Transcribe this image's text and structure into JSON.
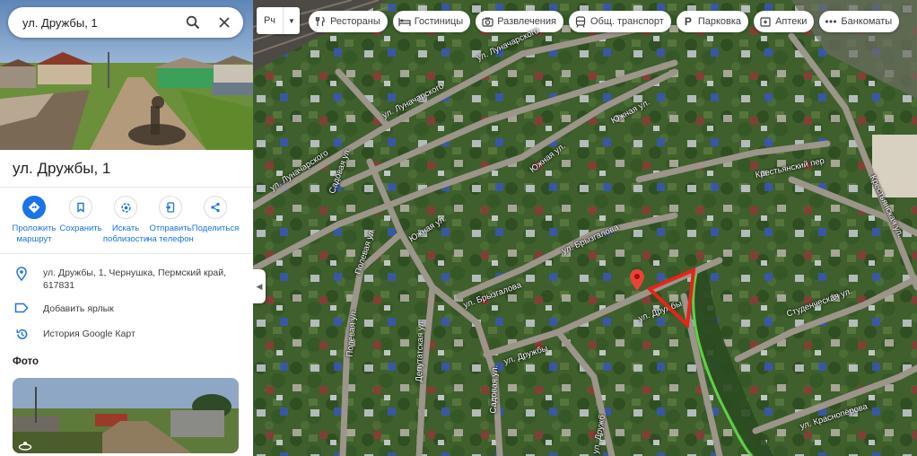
{
  "search": {
    "value": "ул. Дружбы, 1"
  },
  "place": {
    "title": "ул. Дружбы, 1",
    "address": "ул. Дружбы, 1, Чернушка, Пермский край, 617831",
    "add_label": "Добавить ярлык",
    "history": "История Google Карт"
  },
  "actions": [
    {
      "label1": "Проложить",
      "label2": "маршрут"
    },
    {
      "label1": "Сохранить",
      "label2": ""
    },
    {
      "label1": "Искать",
      "label2": "поблизости"
    },
    {
      "label1": "Отправить",
      "label2": "на телефон"
    },
    {
      "label1": "Поделиться",
      "label2": ""
    }
  ],
  "photos_label": "Фото",
  "map": {
    "type_label": "Рч",
    "chips": [
      {
        "label": "Рестораны",
        "icon": "restaurant-icon"
      },
      {
        "label": "Гостиницы",
        "icon": "hotel-icon"
      },
      {
        "label": "Развлечения",
        "icon": "camera-icon"
      },
      {
        "label": "Общ. транспорт",
        "icon": "transit-icon"
      },
      {
        "label": "Парковка",
        "icon": "parking-icon"
      },
      {
        "label": "Аптеки",
        "icon": "pharmacy-icon"
      },
      {
        "label": "Банкоматы",
        "icon": "atm-icon"
      }
    ],
    "streets": [
      {
        "name": "ул. Луначарского"
      },
      {
        "name": "ул. Луначарского"
      },
      {
        "name": "ул. Луначарского"
      },
      {
        "name": "Южная ул."
      },
      {
        "name": "Южная ул."
      },
      {
        "name": "Южная ул."
      },
      {
        "name": "Садовая ул."
      },
      {
        "name": "Садовая ул."
      },
      {
        "name": "Полевая ул."
      },
      {
        "name": "Полевая ул."
      },
      {
        "name": "Депутатская ул."
      },
      {
        "name": "ул. Брызгалова"
      },
      {
        "name": "ул. Брызгалова"
      },
      {
        "name": "ул. Дружбы"
      },
      {
        "name": "ул. Дружбы"
      },
      {
        "name": "Крестьянский пер"
      },
      {
        "name": "Крестьянская ул."
      },
      {
        "name": "Студенческая ул."
      },
      {
        "name": "ул. Краснопёрова"
      },
      {
        "name": "ул. Дружб"
      }
    ]
  },
  "colors": {
    "accent": "#1a73e8",
    "marker": "#ea4335",
    "annotation": "#e8231a"
  }
}
